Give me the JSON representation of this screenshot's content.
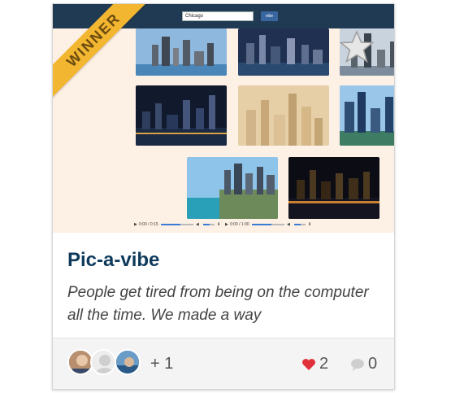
{
  "screenshot": {
    "search_value": "Chicago",
    "button_label": "vibe",
    "player_times": [
      "0:00 / 0:15",
      "0:00 / 1:00"
    ]
  },
  "badge": {
    "label": "WINNER"
  },
  "project": {
    "title": "Pic-a-vibe",
    "description": "People get tired from being on the computer all the time. We made a way"
  },
  "footer": {
    "extra_members": "+ 1",
    "likes": "2",
    "comments": "0"
  },
  "colors": {
    "ribbon": "#f2b630",
    "title": "#0e3a5c",
    "heart": "#e0303a",
    "topbar": "#1f3a52"
  },
  "icons": [
    "star-icon",
    "heart-icon",
    "comment-icon",
    "play-icon",
    "volume-icon",
    "download-icon"
  ]
}
